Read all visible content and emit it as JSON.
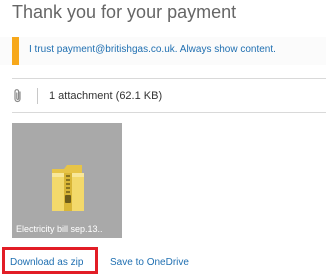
{
  "message": {
    "title": "Thank you for your payment",
    "trust_banner": {
      "text": "I trust payment@britishgas.co.uk. Always show content.",
      "accent_color": "#f7a81b"
    },
    "attachments": {
      "summary": "1 attachment (62.1 KB)",
      "items": [
        {
          "name": "Electricity bill sep.13..",
          "icon": "zip-folder-icon"
        }
      ]
    },
    "actions": {
      "download_zip": "Download as zip",
      "save_onedrive": "Save to OneDrive",
      "highlight_color": "#e21d26"
    }
  }
}
